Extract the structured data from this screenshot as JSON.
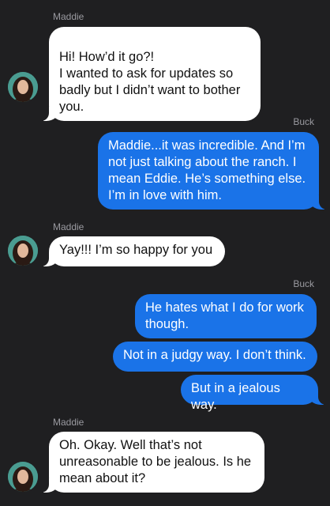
{
  "thread": {
    "groups": [
      {
        "sender": "Maddie",
        "direction": "incoming",
        "messages": [
          "Hi! How’d it go?!\nI wanted to ask for updates so badly but I didn’t want to bother you."
        ]
      },
      {
        "sender": "Buck",
        "direction": "outgoing",
        "messages": [
          "Maddie...it was incredible. And I’m not just talking about the ranch. I mean Eddie. He’s something else. I’m in love with him."
        ]
      },
      {
        "sender": "Maddie",
        "direction": "incoming",
        "messages": [
          "Yay!!! I’m so happy for you"
        ]
      },
      {
        "sender": "Buck",
        "direction": "outgoing",
        "messages": [
          "He hates what I do for work though.",
          "Not in a judgy way. I don’t think.",
          "But in a jealous way."
        ]
      },
      {
        "sender": "Maddie",
        "direction": "incoming",
        "messages": [
          "Oh. Okay. Well that’s not unreasonable to be jealous. Is he mean about it?"
        ]
      }
    ]
  },
  "colors": {
    "background": "#1f1f21",
    "incoming_bubble": "#ffffff",
    "outgoing_bubble": "#1a73e8",
    "sender_label": "#9a9aa0"
  },
  "icons": {
    "avatar": "contact-photo-maddie"
  }
}
